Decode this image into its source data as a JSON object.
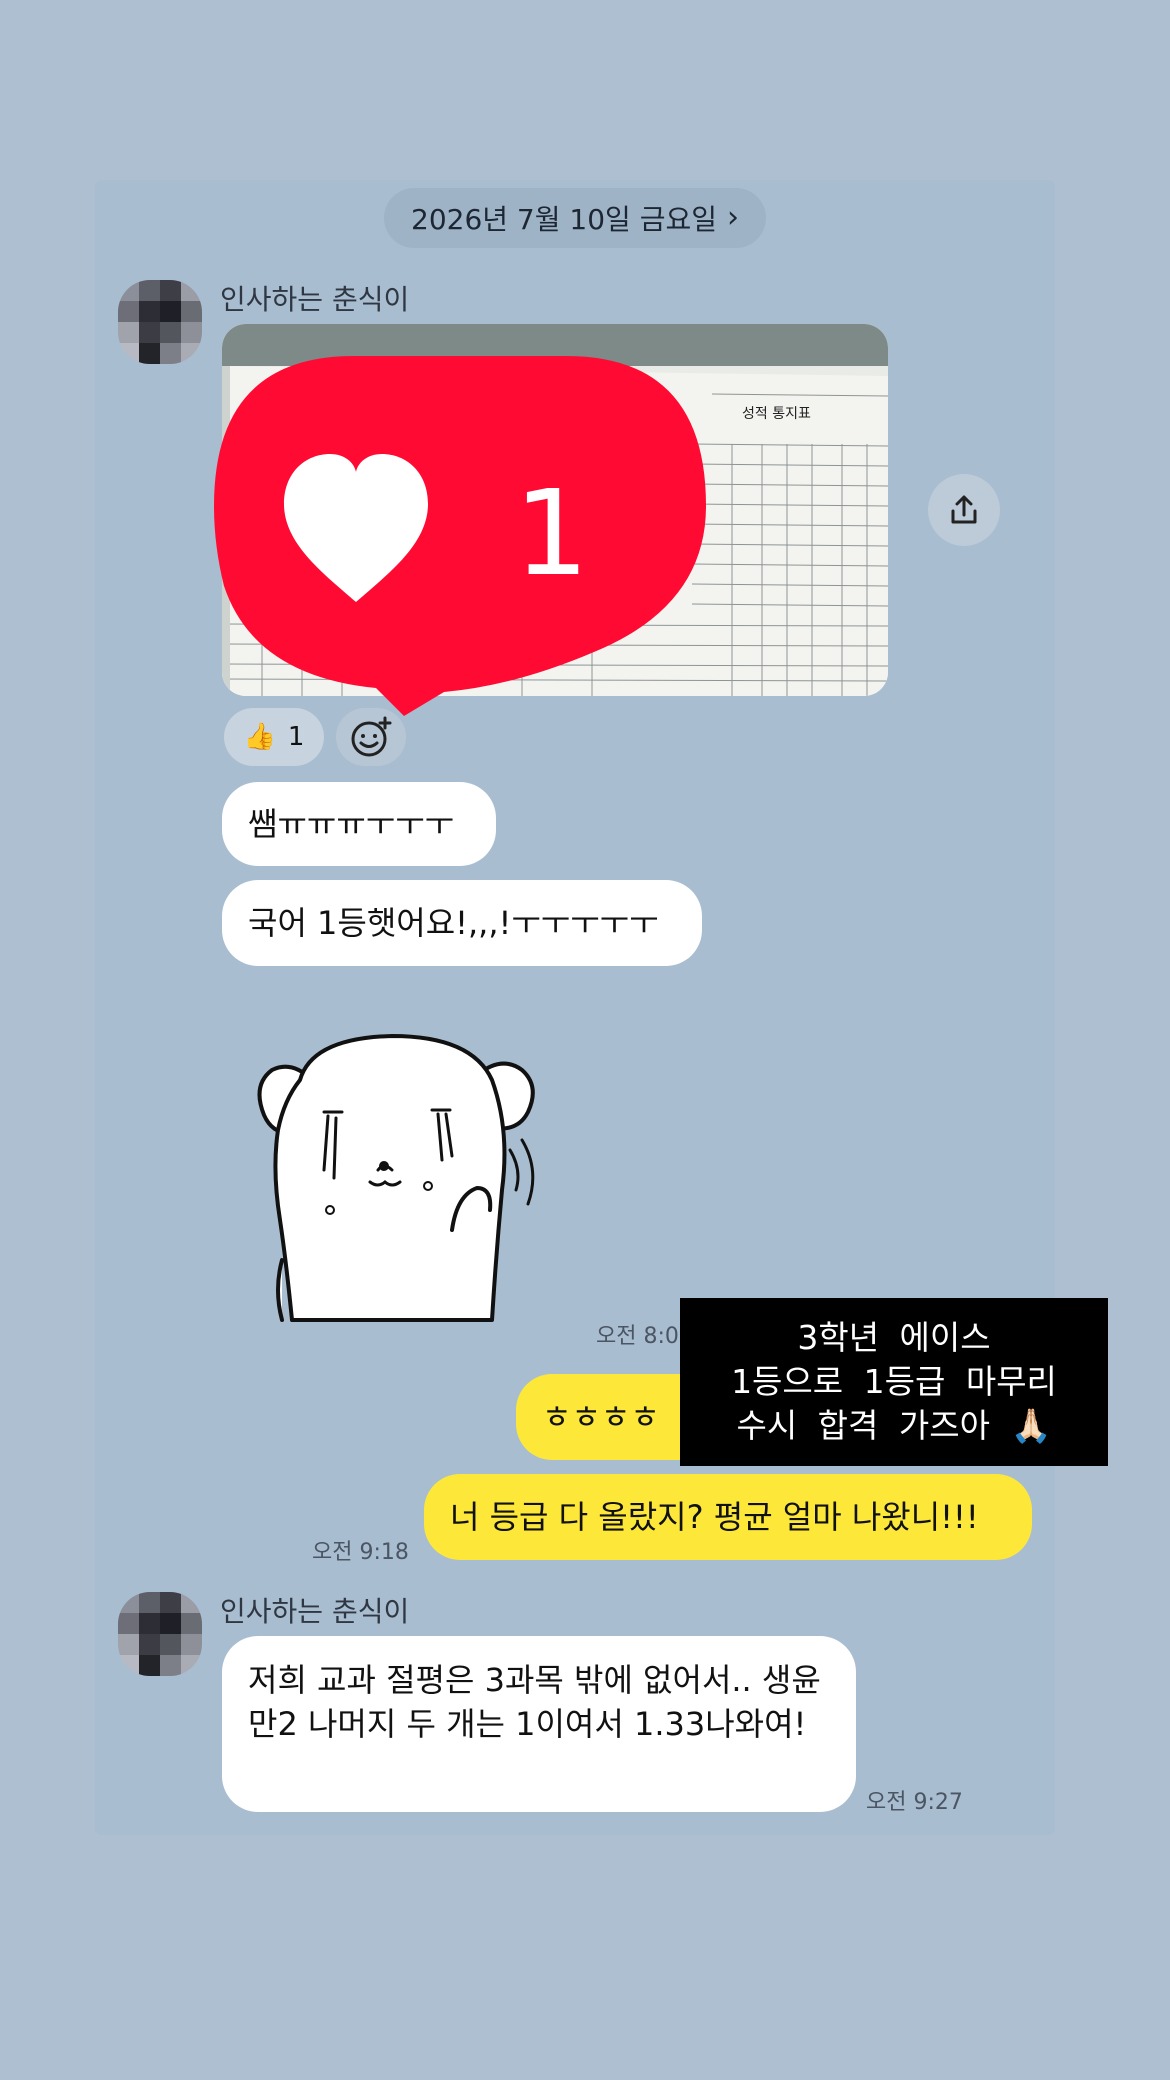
{
  "date_divider": {
    "label": "2026년 7월 10일 금요일",
    "chevron": "chevron-right-icon"
  },
  "messages": {
    "first_group": {
      "sender": "인사하는 춘식이",
      "photo_heading": "성적 통지표",
      "heart_reaction": {
        "icon": "heart-icon",
        "count": "1",
        "color": "#ff0a33"
      },
      "thumbs_reaction": {
        "emoji": "👍",
        "count": "1"
      },
      "add_reaction_icon": "smiley-plus-icon",
      "share_icon": "share-upload-icon",
      "bubble1": "쌤ㅠㅠㅠㅜㅜㅜ",
      "bubble2": "국어 1등햇어요!,,,!ㅜㅜㅜㅜㅜ",
      "sticker": "crying-puppy-sticker",
      "time": "오전 8:0"
    },
    "outgoing": {
      "bubble1": "ㅎㅎㅎㅎ",
      "bubble2": "너 등급 다 올랐지? 평균 얼마 나왔니!!!",
      "time": "오전 9:18",
      "bubble_color": "#fde83a"
    },
    "second_group": {
      "sender": "인사하는 춘식이",
      "text": "저희 교과 절평은 3과목 밖에 없어서.. 생윤만2 나머지 두 개는 1이여서 1.33나와여!",
      "time": "오전 9:27"
    }
  },
  "caption_overlay": {
    "line1": "3학년 에이스",
    "line2": "1등으로 1등급 마무리",
    "line3": "수시 합격 가즈아",
    "emoji": "🙏🏻"
  }
}
